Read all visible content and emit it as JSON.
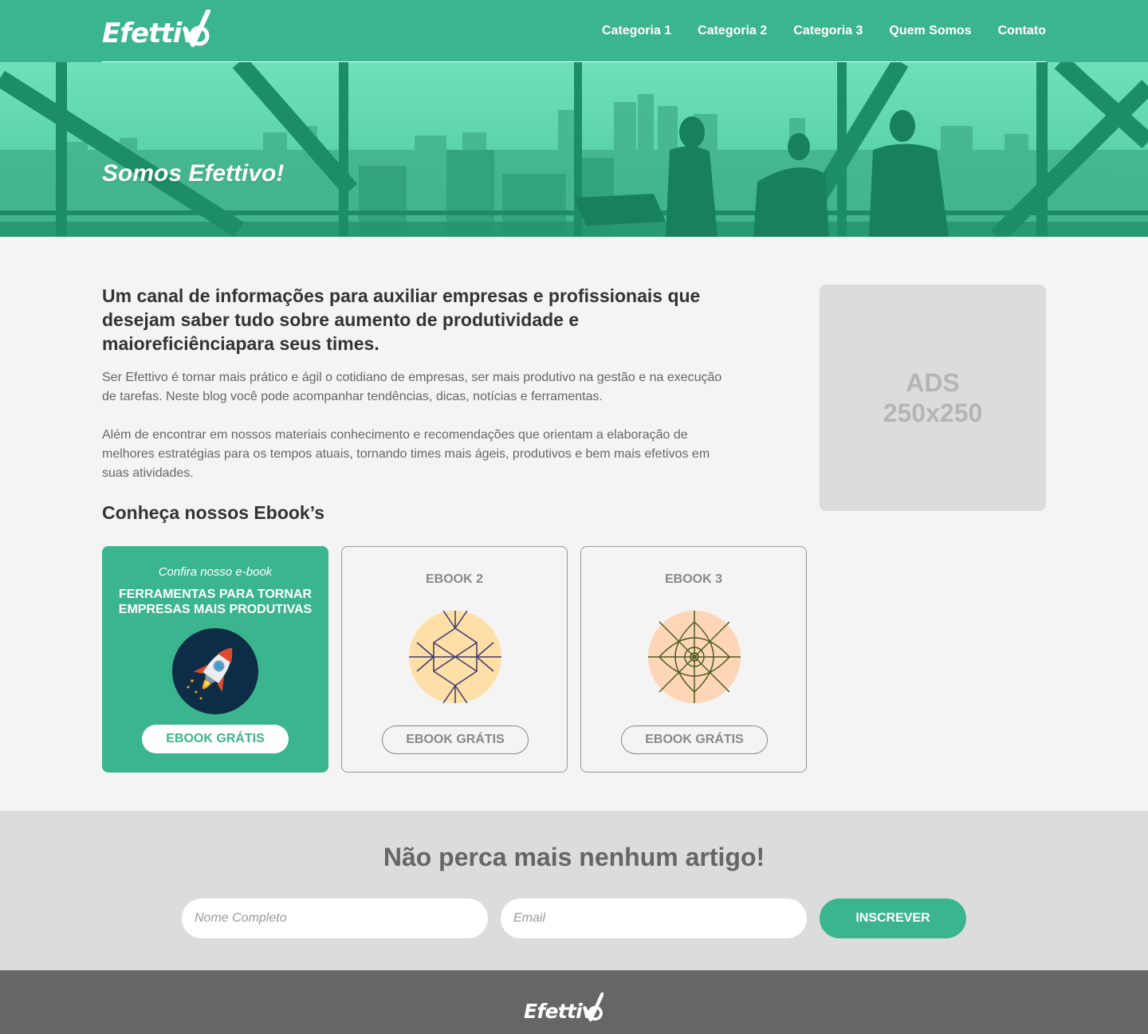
{
  "brand": {
    "name": "Efettivo",
    "accent": "#3bb58f"
  },
  "nav": {
    "items": [
      "Categoria 1",
      "Categoria 2",
      "Categoria 3",
      "Quem Somos",
      "Contato"
    ]
  },
  "hero": {
    "title": "Somos Efettivo!"
  },
  "intro": {
    "title": "Um canal de informações para auxiliar empresas e profissionais que desejam saber tudo sobre aumento de produtividade e maioreficiênciapara seus times.",
    "paragraph1": "Ser Efettivo é tornar mais prático e ágil o cotidiano de empresas, ser mais produtivo na gestão e na execução de tarefas. Neste blog você pode acompanhar tendências, dicas, notícias e ferramentas.",
    "paragraph2": "Além de encontrar em nossos materiais conhecimento e recomendações que orientam a elaboração de melhores estratégias para os tempos atuais, tornando times mais ágeis, produtivos e bem mais efetivos em suas atividades."
  },
  "ads": {
    "line1": "ADS",
    "line2": "250x250"
  },
  "ebooks": {
    "title": "Conheça nossos Ebook’s",
    "cards": [
      {
        "pre": "Confira nosso e-book",
        "headline": "FERRAMENTAS PARA TORNAR EMPRESAS MAIS PRODUTIVAS",
        "button": "EBOOK GRÁTIS",
        "icon": "rocket-icon"
      },
      {
        "label": "EBOOK 2",
        "button": "EBOOK GRÁTIS",
        "icon": "hexagon-pattern-icon"
      },
      {
        "label": "EBOOK 3",
        "button": "EBOOK GRÁTIS",
        "icon": "eye-pattern-icon"
      }
    ]
  },
  "newsletter": {
    "title": "Não perca mais nenhum artigo!",
    "name_placeholder": "Nome Completo",
    "email_placeholder": "Email",
    "button": "INSCREVER"
  },
  "footer": {
    "logo": "Efettivo"
  }
}
